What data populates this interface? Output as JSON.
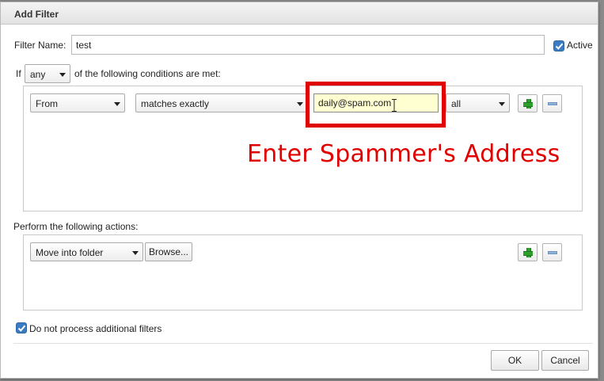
{
  "dialog": {
    "title": "Add Filter",
    "filter_name_label": "Filter Name:",
    "filter_name_value": "test",
    "active_label": "Active",
    "active_checked": true
  },
  "conditions": {
    "if_label": "If",
    "match_mode": "any",
    "suffix_label": "of the following conditions are met:",
    "rows": [
      {
        "field": "From",
        "operator": "matches exactly",
        "value": "daily@spam.com",
        "scope": "all"
      }
    ]
  },
  "actions": {
    "heading": "Perform the following actions:",
    "rows": [
      {
        "action": "Move into folder",
        "browse_label": "Browse..."
      }
    ]
  },
  "options": {
    "stop_processing_label": "Do not process additional filters",
    "stop_processing_checked": true
  },
  "footer": {
    "ok_label": "OK",
    "cancel_label": "Cancel"
  },
  "annotation": {
    "text": "Enter Spammer's Address",
    "color": "#e00000"
  },
  "icons": {
    "add": "plus-icon",
    "remove": "minus-icon",
    "checkbox": "checkmark-icon",
    "dropdown": "chevron-down-icon"
  }
}
